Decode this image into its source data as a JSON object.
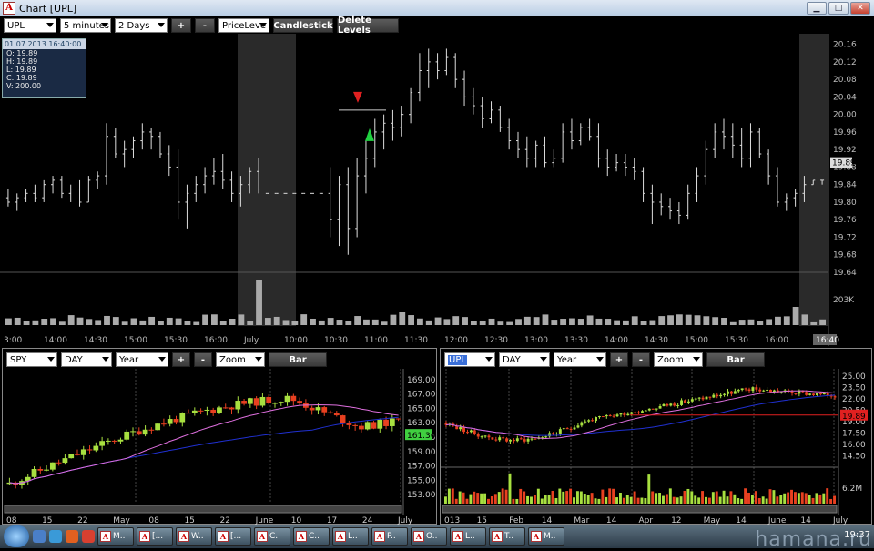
{
  "window": {
    "title": "Chart [UPL]",
    "app_icon": "A"
  },
  "main_toolbar": {
    "symbol": "UPL",
    "interval": "5 minutes",
    "range": "2 Days",
    "plus_label": "+",
    "minus_label": "-",
    "study": "PriceLeve",
    "candlestick_label": "Candlestick",
    "delete_levels_label": "Delete Levels"
  },
  "ohlc_box": {
    "date": "01.07.2013 16:40:00",
    "open": "O: 19.89",
    "high": "H: 19.89",
    "low": "L: 19.89",
    "close": "C: 19.89",
    "volume": "V: 200.00"
  },
  "main_chart": {
    "price_ticks": [
      "20.16",
      "20.12",
      "20.08",
      "20.04",
      "20.00",
      "19.96",
      "19.92",
      "19.88",
      "19.84",
      "19.80",
      "19.76",
      "19.72",
      "19.68",
      "19.64"
    ],
    "last_price": "19.89",
    "volume_tick": "203K",
    "time_labels": [
      "3:00",
      "14:00",
      "14:30",
      "15:00",
      "15:30",
      "16:00",
      "July",
      "10:00",
      "10:30",
      "11:00",
      "11:30",
      "12:00",
      "12:30",
      "13:00",
      "13:30",
      "14:00",
      "14:30",
      "15:00",
      "15:30",
      "16:00",
      "16:40"
    ]
  },
  "chart_data": [
    {
      "type": "candlestick",
      "symbol": "UPL",
      "interval": "5 minutes",
      "ylim": [
        19.64,
        20.18
      ],
      "last": 19.89,
      "price_level": 20.01,
      "bars": [
        [
          19.81,
          19.83,
          19.79,
          19.8
        ],
        [
          19.8,
          19.82,
          19.78,
          19.81
        ],
        [
          19.81,
          19.83,
          19.8,
          19.82
        ],
        [
          19.82,
          19.84,
          19.8,
          19.81
        ],
        [
          19.81,
          19.85,
          19.8,
          19.84
        ],
        [
          19.84,
          19.86,
          19.82,
          19.85
        ],
        [
          19.85,
          19.86,
          19.81,
          19.82
        ],
        [
          19.82,
          19.84,
          19.8,
          19.83
        ],
        [
          19.83,
          19.85,
          19.79,
          19.8
        ],
        [
          19.8,
          19.86,
          19.8,
          19.85
        ],
        [
          19.85,
          19.87,
          19.83,
          19.86
        ],
        [
          19.86,
          19.98,
          19.84,
          19.95
        ],
        [
          19.95,
          19.97,
          19.9,
          19.91
        ],
        [
          19.91,
          19.94,
          19.88,
          19.92
        ],
        [
          19.92,
          19.95,
          19.9,
          19.94
        ],
        [
          19.94,
          19.98,
          19.92,
          19.96
        ],
        [
          19.96,
          19.97,
          19.92,
          19.95
        ],
        [
          19.95,
          19.96,
          19.9,
          19.91
        ],
        [
          19.91,
          19.93,
          19.86,
          19.88
        ],
        [
          19.88,
          19.92,
          19.76,
          19.8
        ],
        [
          19.8,
          19.84,
          19.74,
          19.82
        ],
        [
          19.82,
          19.86,
          19.8,
          19.84
        ],
        [
          19.84,
          19.88,
          19.82,
          19.86
        ],
        [
          19.86,
          19.9,
          19.84,
          19.87
        ],
        [
          19.87,
          19.91,
          19.83,
          19.85
        ],
        [
          19.85,
          19.87,
          19.8,
          19.82
        ],
        [
          19.82,
          19.86,
          19.79,
          19.84
        ],
        [
          19.84,
          19.88,
          19.82,
          19.87
        ],
        [
          19.87,
          19.9,
          19.82,
          19.83
        ],
        [
          19.82,
          19.82,
          19.82,
          19.82
        ],
        [
          19.82,
          19.82,
          19.82,
          19.82
        ],
        [
          19.82,
          19.82,
          19.82,
          19.82
        ],
        [
          19.82,
          19.82,
          19.82,
          19.82
        ],
        [
          19.82,
          19.82,
          19.82,
          19.82
        ],
        [
          19.82,
          19.82,
          19.82,
          19.82
        ],
        [
          19.82,
          19.82,
          19.82,
          19.82
        ],
        [
          19.82,
          19.88,
          19.72,
          19.76
        ],
        [
          19.76,
          19.86,
          19.7,
          19.84
        ],
        [
          19.84,
          19.88,
          19.68,
          19.74
        ],
        [
          19.74,
          19.9,
          19.72,
          19.86
        ],
        [
          19.86,
          19.94,
          19.82,
          19.9
        ],
        [
          19.9,
          19.99,
          19.88,
          19.96
        ],
        [
          19.96,
          20.0,
          19.92,
          19.98
        ],
        [
          19.98,
          20.01,
          19.94,
          19.97
        ],
        [
          19.97,
          20.02,
          19.95,
          20.0
        ],
        [
          20.0,
          20.06,
          19.98,
          20.05
        ],
        [
          20.05,
          20.14,
          20.03,
          20.1
        ],
        [
          20.1,
          20.15,
          20.06,
          20.12
        ],
        [
          20.12,
          20.14,
          20.08,
          20.1
        ],
        [
          20.1,
          20.15,
          20.09,
          20.13
        ],
        [
          20.13,
          20.14,
          20.06,
          20.08
        ],
        [
          20.08,
          20.1,
          20.02,
          20.04
        ],
        [
          20.04,
          20.06,
          20.0,
          20.02
        ],
        [
          20.02,
          20.04,
          19.97,
          19.99
        ],
        [
          19.99,
          20.03,
          19.98,
          20.01
        ],
        [
          20.01,
          20.02,
          19.96,
          19.97
        ],
        [
          19.97,
          19.99,
          19.92,
          19.94
        ],
        [
          19.94,
          19.96,
          19.9,
          19.92
        ],
        [
          19.92,
          19.95,
          19.88,
          19.9
        ],
        [
          19.9,
          19.94,
          19.88,
          19.93
        ],
        [
          19.93,
          19.95,
          19.88,
          19.89
        ],
        [
          19.89,
          19.92,
          19.88,
          19.9
        ],
        [
          19.9,
          19.98,
          19.89,
          19.96
        ],
        [
          19.96,
          19.99,
          19.92,
          19.94
        ],
        [
          19.94,
          19.98,
          19.93,
          19.97
        ],
        [
          19.97,
          19.99,
          19.94,
          19.95
        ],
        [
          19.95,
          19.98,
          19.88,
          19.9
        ],
        [
          19.9,
          19.92,
          19.86,
          19.88
        ],
        [
          19.88,
          19.91,
          19.87,
          19.89
        ],
        [
          19.89,
          19.91,
          19.86,
          19.88
        ],
        [
          19.88,
          19.9,
          19.85,
          19.87
        ],
        [
          19.87,
          19.88,
          19.8,
          19.82
        ],
        [
          19.82,
          19.84,
          19.75,
          19.8
        ],
        [
          19.8,
          19.82,
          19.77,
          19.79
        ],
        [
          19.79,
          19.81,
          19.76,
          19.78
        ],
        [
          19.78,
          19.8,
          19.75,
          19.77
        ],
        [
          19.77,
          19.84,
          19.76,
          19.82
        ],
        [
          19.82,
          19.88,
          19.8,
          19.86
        ],
        [
          19.86,
          19.94,
          19.84,
          19.92
        ],
        [
          19.92,
          19.98,
          19.9,
          19.96
        ],
        [
          19.96,
          19.99,
          19.92,
          19.95
        ],
        [
          19.95,
          19.98,
          19.9,
          19.93
        ],
        [
          19.93,
          19.97,
          19.88,
          19.9
        ],
        [
          19.9,
          19.98,
          19.88,
          19.96
        ],
        [
          19.96,
          19.97,
          19.9,
          19.91
        ],
        [
          19.91,
          19.92,
          19.84,
          19.86
        ],
        [
          19.86,
          19.88,
          19.79,
          19.8
        ],
        [
          19.8,
          19.82,
          19.78,
          19.81
        ],
        [
          19.81,
          19.83,
          19.79,
          19.82
        ],
        [
          19.82,
          19.86,
          19.8,
          19.84
        ],
        [
          19.84,
          19.85,
          19.84,
          19.85
        ],
        [
          19.85,
          19.85,
          19.84,
          19.85
        ]
      ]
    },
    {
      "type": "candlestick",
      "symbol": "SPY",
      "interval": "DAY",
      "ylim": [
        152,
        170
      ],
      "last": 161.36,
      "y_ticks": [
        "169.00",
        "167.00",
        "165.00",
        "163.00",
        "161.00",
        "159.00",
        "157.00",
        "155.00",
        "153.00"
      ],
      "x_labels": [
        "08",
        "15",
        "22",
        "May",
        "08",
        "15",
        "22",
        "June",
        "10",
        "17",
        "24",
        "July"
      ]
    },
    {
      "type": "candlestick",
      "symbol": "UPL",
      "interval": "DAY",
      "ylim": [
        13.5,
        25.5
      ],
      "last": 19.89,
      "y_ticks": [
        "25.00",
        "23.50",
        "22.00",
        "20.50",
        "19.00",
        "17.50",
        "16.00",
        "14.50"
      ],
      "volume_tick": "6.2M",
      "x_labels": [
        "013",
        "15",
        "Feb",
        "14",
        "Mar",
        "14",
        "Apr",
        "12",
        "May",
        "14",
        "June",
        "14",
        "July"
      ]
    }
  ],
  "left_panel": {
    "symbol": "SPY",
    "interval": "DAY",
    "range": "Year",
    "plus_label": "+",
    "minus_label": "-",
    "zoom": "Zoom",
    "bar_label": "Bar",
    "last_price": "161.36"
  },
  "right_panel": {
    "symbol": "UPL",
    "interval": "DAY",
    "range": "Year",
    "plus_label": "+",
    "minus_label": "-",
    "zoom": "Zoom",
    "bar_label": "Bar",
    "last_price": "19.89"
  },
  "taskbar": {
    "tasks": [
      "M..",
      "[...",
      "W..",
      "[...",
      "C..",
      "C..",
      "L..",
      "P..",
      "O..",
      "L..",
      "T..",
      "M.."
    ],
    "clock": "19:37"
  },
  "watermark": "hamana.ru",
  "colors": {
    "up": "#a8e040",
    "down": "#e84020",
    "sma_blue": "#2030d0",
    "sma_pink": "#e070e0",
    "level": "#e02020"
  }
}
